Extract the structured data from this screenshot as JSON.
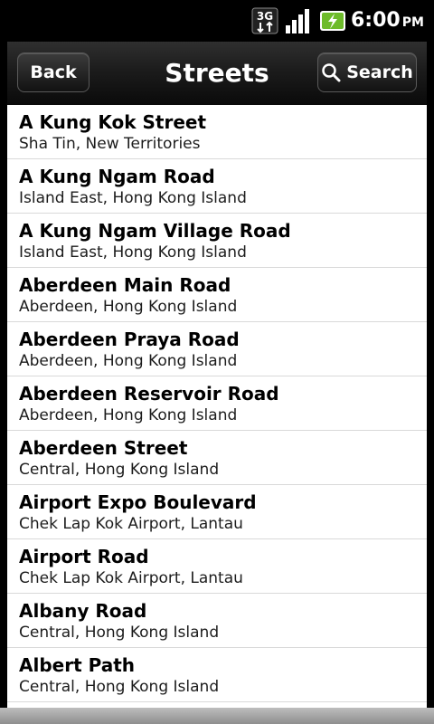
{
  "status_bar": {
    "network_icon": "3g-icon",
    "network_label": "3G",
    "signal_icon": "signal-icon",
    "battery_icon": "battery-charging-icon",
    "time": "6:00",
    "ampm": "PM"
  },
  "header": {
    "title": "Streets",
    "back_label": "Back",
    "search_label": "Search",
    "search_icon": "search-icon"
  },
  "streets": [
    {
      "name": "A Kung Kok Street",
      "district": "Sha Tin, New Territories"
    },
    {
      "name": "A Kung Ngam Road",
      "district": "Island East, Hong Kong Island"
    },
    {
      "name": "A Kung Ngam Village Road",
      "district": "Island East, Hong Kong Island"
    },
    {
      "name": "Aberdeen Main Road",
      "district": "Aberdeen, Hong Kong Island"
    },
    {
      "name": "Aberdeen Praya Road",
      "district": "Aberdeen, Hong Kong Island"
    },
    {
      "name": "Aberdeen Reservoir Road",
      "district": "Aberdeen, Hong Kong Island"
    },
    {
      "name": "Aberdeen Street",
      "district": "Central, Hong Kong Island"
    },
    {
      "name": "Airport Expo Boulevard",
      "district": "Chek Lap Kok Airport, Lantau"
    },
    {
      "name": "Airport Road",
      "district": "Chek Lap Kok Airport, Lantau"
    },
    {
      "name": "Albany Road",
      "district": "Central, Hong Kong Island"
    },
    {
      "name": "Albert Path",
      "district": "Central, Hong Kong Island"
    }
  ],
  "colors": {
    "header_bg": "#1c1c1c",
    "list_bg": "#ffffff",
    "divider": "#d9d9d9",
    "battery_green": "#6dbb2a"
  }
}
